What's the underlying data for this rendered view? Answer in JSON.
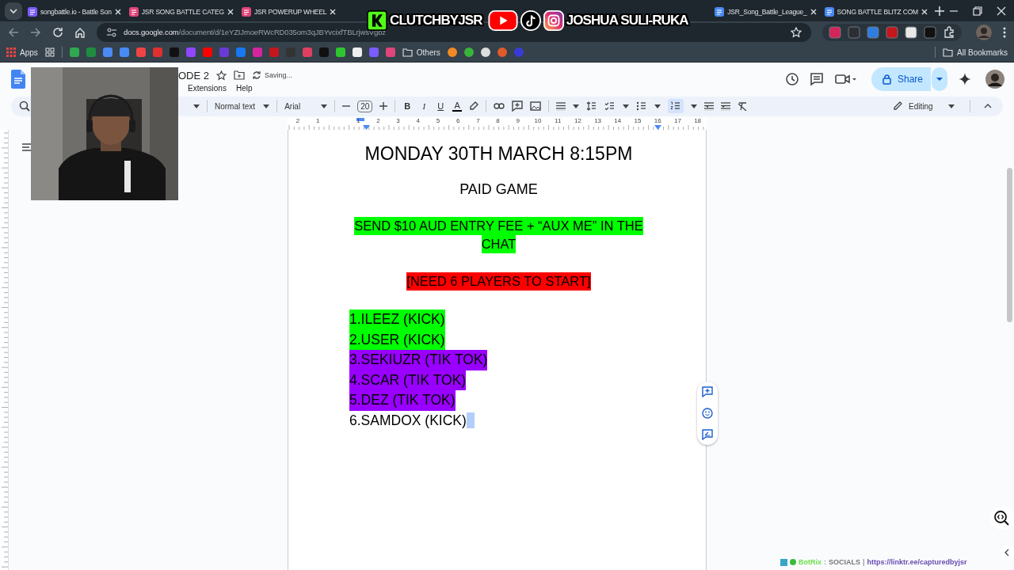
{
  "browser": {
    "tabs_left": [
      {
        "title": "songbattle.io - Battle Son",
        "selected": false
      },
      {
        "title": "JSR SONG BATTLE CATEG",
        "selected": false
      },
      {
        "title": "JSR POWERUP WHEEL",
        "selected": false
      }
    ],
    "tabs_right": [
      {
        "title": "JSR_Song_Battle_League_",
        "selected": false
      },
      {
        "title": "SONG BATTLE BLITZ COM",
        "selected": false
      }
    ],
    "url_host": "docs.google.com",
    "url_path": "/document/d/1eYZIJmoeRWcRD035om3qJBYvcixfTBLrjwsVgbz",
    "bookmarks": {
      "apps": "Apps",
      "others": "Others",
      "all": "All Bookmarks"
    }
  },
  "docs": {
    "title": "ODE 2",
    "status": "Saving...",
    "menu": [
      "Extensions",
      "Help"
    ],
    "share": "Share",
    "toolbar": {
      "style": "Normal text",
      "font": "Arial",
      "size": "20",
      "mode": "Editing",
      "format_buttons": [
        {
          "kind": "bold",
          "label": "B"
        },
        {
          "kind": "italic",
          "label": "I"
        },
        {
          "kind": "underline",
          "label": "U"
        },
        {
          "kind": "text_color",
          "label": "A"
        }
      ],
      "numbered_list": {
        "selected": true
      }
    },
    "ruler": [
      "2",
      "1",
      "1",
      "2",
      "3",
      "4",
      "5",
      "6",
      "7",
      "8",
      "9",
      "10",
      "11",
      "12",
      "13",
      "14",
      "15",
      "16",
      "17",
      "18"
    ]
  },
  "document": {
    "lines": [
      {
        "kind": "title",
        "text": "MONDAY 30TH MARCH 8:15PM"
      },
      {
        "kind": "subtitle",
        "text": "PAID GAME"
      },
      {
        "kind": "notice",
        "text_lines": [
          "SEND $10 AUD ENTRY FEE + “AUX ME” IN THE",
          "CHAT"
        ],
        "color": "#00ff00"
      },
      {
        "kind": "notice",
        "text_lines": [
          "[NEED 6 PLAYERS TO START]"
        ],
        "color": "#ff0000"
      }
    ],
    "players": [
      {
        "text": "1.ILEEZ (KICK)",
        "color": "#00ff00",
        "cursor": false
      },
      {
        "text": "2.USER (KICK)",
        "color": "#00ff00",
        "cursor": false
      },
      {
        "text": "3.SEKIUZR (TIK TOK)",
        "color": "#9900ff",
        "cursor": false
      },
      {
        "text": "4.SCAR (TIK TOK)",
        "color": "#9900ff",
        "cursor": false
      },
      {
        "text": "5.DEZ (TIK TOK)",
        "color": "#9900ff",
        "cursor": false
      },
      {
        "text": "6.SAMDOX (KICK)",
        "cursor": true
      }
    ]
  },
  "overlay": {
    "banner_left": "CLUTCHBYJSR",
    "banner_right": "JOSHUA SULI-RUKA",
    "ticker_source": "BotRix",
    "ticker_sep": ":",
    "ticker_label": "SOCIALS",
    "ticker_bar": "|",
    "ticker_link": "https://linktr.ee/capturedbyjsr"
  }
}
